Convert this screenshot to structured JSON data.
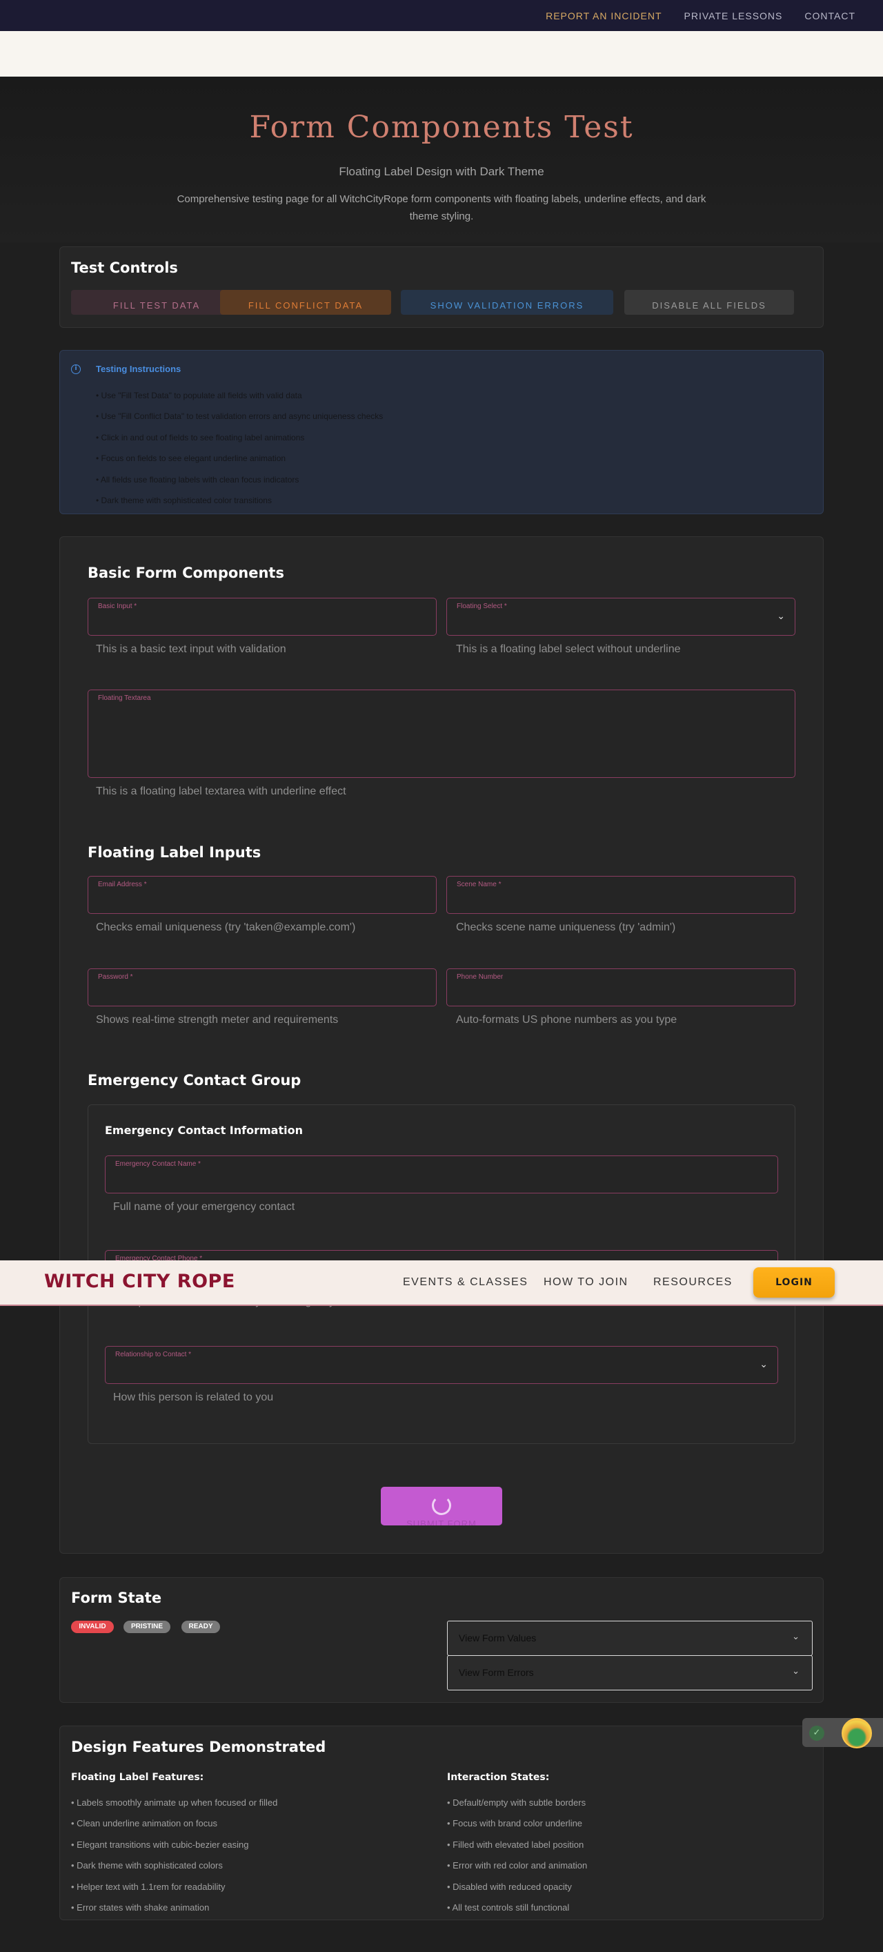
{
  "utility_nav": {
    "links": [
      "REPORT AN INCIDENT",
      "PRIVATE LESSONS",
      "CONTACT"
    ],
    "accent_color": "#d8aa64"
  },
  "hero": {
    "title": "Form Components Test",
    "subtitle": "Floating Label Design with Dark Theme",
    "description": "Comprehensive testing page for all WitchCityRope form components with floating labels, underline effects, and dark theme styling."
  },
  "test_controls": {
    "title": "Test Controls",
    "buttons": [
      "FILL TEST DATA",
      "FILL CONFLICT DATA",
      "SHOW VALIDATION ERRORS",
      "DISABLE ALL FIELDS"
    ]
  },
  "instructions": {
    "title": "Testing Instructions",
    "items": [
      "• Use \"Fill Test Data\" to populate all fields with valid data",
      "• Use \"Fill Conflict Data\" to test validation errors and async uniqueness checks",
      "• Click in and out of fields to see floating label animations",
      "• Focus on fields to see elegant underline animation",
      "• All fields use floating labels with clean focus indicators",
      "• Dark theme with sophisticated color transitions"
    ]
  },
  "basic_section": {
    "title": "Basic Form Components",
    "basic_input": {
      "label": "Basic Input *",
      "helper": "This is a basic text input with validation"
    },
    "floating_select": {
      "label": "Floating Select *",
      "helper": "This is a floating label select without underline"
    },
    "textarea": {
      "label": "Floating Textarea",
      "helper": "This is a floating label textarea with underline effect"
    }
  },
  "floating_section": {
    "title": "Floating Label Inputs",
    "email": {
      "label": "Email Address *",
      "helper": "Checks email uniqueness (try 'taken@example.com')"
    },
    "scene_name": {
      "label": "Scene Name *",
      "helper": "Checks scene name uniqueness (try 'admin')"
    },
    "password": {
      "label": "Password *",
      "helper": "Shows real-time strength meter and requirements"
    },
    "phone": {
      "label": "Phone Number",
      "helper": "Auto-formats US phone numbers as you type"
    }
  },
  "emergency_section": {
    "title": "Emergency Contact Group",
    "card_title": "Emergency Contact Information",
    "name": {
      "label": "Emergency Contact Name *",
      "helper": "Full name of your emergency contact"
    },
    "phone": {
      "label": "Emergency Contact Phone *",
      "helper": "Best phone number to reach your emergency contact"
    },
    "relationship": {
      "label": "Relationship to Contact *",
      "helper": "How this person is related to you"
    }
  },
  "submit": {
    "label": "SUBMIT FORM",
    "color": "#c45ad1"
  },
  "main_nav": {
    "brand": "WITCH CITY ROPE",
    "links": [
      "EVENTS & CLASSES",
      "HOW TO JOIN",
      "RESOURCES"
    ],
    "login": "LOGIN",
    "brand_color": "#8c1430",
    "login_color": "#ffb21c"
  },
  "form_state": {
    "title": "Form State",
    "badges": [
      "INVALID",
      "PRISTINE",
      "READY"
    ],
    "badge_colors": [
      "#e5484d",
      "#7a7a7a",
      "#7a7a7a"
    ],
    "accordions": [
      "View Form Values",
      "View Form Errors"
    ]
  },
  "design_features": {
    "title": "Design Features Demonstrated",
    "floating_label_features": {
      "heading": "Floating Label Features:",
      "items": [
        "• Labels smoothly animate up when focused or filled",
        "• Clean underline animation on focus",
        "• Elegant transitions with cubic-bezier easing",
        "• Dark theme with sophisticated colors",
        "• Helper text with 1.1rem for readability",
        "• Error states with shake animation"
      ]
    },
    "interaction_states": {
      "heading": "Interaction States:",
      "items": [
        "• Default/empty with subtle borders",
        "• Focus with brand color underline",
        "• Filled with elevated label position",
        "• Error with red color and animation",
        "• Disabled with reduced opacity",
        "• All test controls still functional"
      ]
    }
  }
}
